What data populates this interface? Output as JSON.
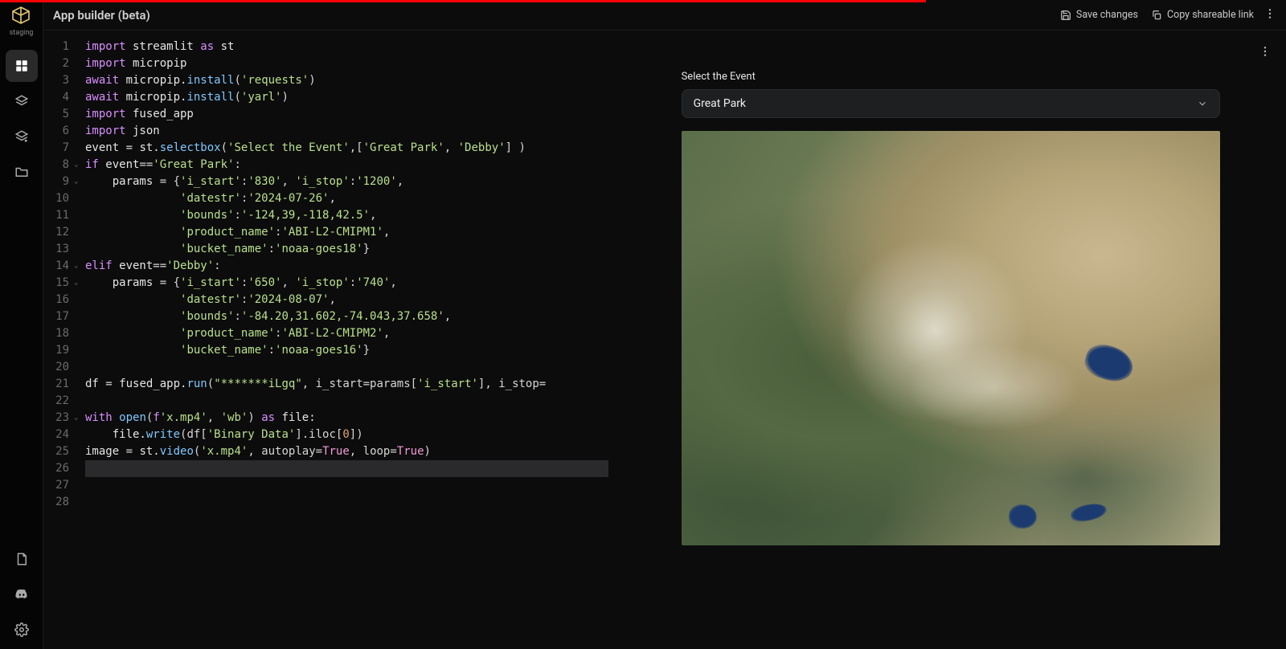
{
  "env_label": "staging",
  "header": {
    "title": "App builder (beta)",
    "save": "Save changes",
    "copy": "Copy shareable link"
  },
  "preview": {
    "label": "Select the Event",
    "selected": "Great Park"
  },
  "code": {
    "total_lines": 28,
    "fold_lines": [
      8,
      9,
      14,
      15,
      23
    ],
    "current_line": 26,
    "lines": [
      [
        [
          "kw",
          "import"
        ],
        [
          "ident",
          " streamlit "
        ],
        [
          "kw",
          "as"
        ],
        [
          "ident",
          " st"
        ]
      ],
      [
        [
          "kw",
          "import"
        ],
        [
          "ident",
          " micropip"
        ]
      ],
      [
        [
          "kw",
          "await"
        ],
        [
          "ident",
          " micropip."
        ],
        [
          "fn",
          "install"
        ],
        [
          "punc",
          "("
        ],
        [
          "str",
          "'requests'"
        ],
        [
          "punc",
          ")"
        ]
      ],
      [
        [
          "kw",
          "await"
        ],
        [
          "ident",
          " micropip."
        ],
        [
          "fn",
          "install"
        ],
        [
          "punc",
          "("
        ],
        [
          "str",
          "'yarl'"
        ],
        [
          "punc",
          ")"
        ]
      ],
      [
        [
          "kw",
          "import"
        ],
        [
          "ident",
          " fused_app"
        ]
      ],
      [
        [
          "kw",
          "import"
        ],
        [
          "ident",
          " json"
        ]
      ],
      [
        [
          "ident",
          "event "
        ],
        [
          "punc",
          "= "
        ],
        [
          "ident",
          "st."
        ],
        [
          "fn",
          "selectbox"
        ],
        [
          "punc",
          "("
        ],
        [
          "str",
          "'Select the Event'"
        ],
        [
          "punc",
          ",["
        ],
        [
          "str",
          "'Great Park'"
        ],
        [
          "punc",
          ", "
        ],
        [
          "str",
          "'Debby'"
        ],
        [
          "punc",
          "] )"
        ]
      ],
      [
        [
          "kw",
          "if"
        ],
        [
          "ident",
          " event"
        ],
        [
          "punc",
          "=="
        ],
        [
          "str",
          "'Great Park'"
        ],
        [
          "punc",
          ":"
        ]
      ],
      [
        [
          "ident",
          "    params "
        ],
        [
          "punc",
          "= {"
        ],
        [
          "str",
          "'i_start'"
        ],
        [
          "punc",
          ":"
        ],
        [
          "str",
          "'830'"
        ],
        [
          "punc",
          ", "
        ],
        [
          "str",
          "'i_stop'"
        ],
        [
          "punc",
          ":"
        ],
        [
          "str",
          "'1200'"
        ],
        [
          "punc",
          ","
        ]
      ],
      [
        [
          "ident",
          "              "
        ],
        [
          "str",
          "'datestr'"
        ],
        [
          "punc",
          ":"
        ],
        [
          "str",
          "'2024-07-26'"
        ],
        [
          "punc",
          ","
        ]
      ],
      [
        [
          "ident",
          "              "
        ],
        [
          "str",
          "'bounds'"
        ],
        [
          "punc",
          ":"
        ],
        [
          "str",
          "'-124,39,-118,42.5'"
        ],
        [
          "punc",
          ","
        ]
      ],
      [
        [
          "ident",
          "              "
        ],
        [
          "str",
          "'product_name'"
        ],
        [
          "punc",
          ":"
        ],
        [
          "str",
          "'ABI-L2-CMIPM1'"
        ],
        [
          "punc",
          ","
        ]
      ],
      [
        [
          "ident",
          "              "
        ],
        [
          "str",
          "'bucket_name'"
        ],
        [
          "punc",
          ":"
        ],
        [
          "str",
          "'noaa-goes18'"
        ],
        [
          "punc",
          "}"
        ]
      ],
      [
        [
          "kw",
          "elif"
        ],
        [
          "ident",
          " event"
        ],
        [
          "punc",
          "=="
        ],
        [
          "str",
          "'Debby'"
        ],
        [
          "punc",
          ":"
        ]
      ],
      [
        [
          "ident",
          "    params "
        ],
        [
          "punc",
          "= {"
        ],
        [
          "str",
          "'i_start'"
        ],
        [
          "punc",
          ":"
        ],
        [
          "str",
          "'650'"
        ],
        [
          "punc",
          ", "
        ],
        [
          "str",
          "'i_stop'"
        ],
        [
          "punc",
          ":"
        ],
        [
          "str",
          "'740'"
        ],
        [
          "punc",
          ","
        ]
      ],
      [
        [
          "ident",
          "              "
        ],
        [
          "str",
          "'datestr'"
        ],
        [
          "punc",
          ":"
        ],
        [
          "str",
          "'2024-08-07'"
        ],
        [
          "punc",
          ","
        ]
      ],
      [
        [
          "ident",
          "              "
        ],
        [
          "str",
          "'bounds'"
        ],
        [
          "punc",
          ":"
        ],
        [
          "str",
          "'-84.20,31.602,-74.043,37.658'"
        ],
        [
          "punc",
          ","
        ]
      ],
      [
        [
          "ident",
          "              "
        ],
        [
          "str",
          "'product_name'"
        ],
        [
          "punc",
          ":"
        ],
        [
          "str",
          "'ABI-L2-CMIPM2'"
        ],
        [
          "punc",
          ","
        ]
      ],
      [
        [
          "ident",
          "              "
        ],
        [
          "str",
          "'bucket_name'"
        ],
        [
          "punc",
          ":"
        ],
        [
          "str",
          "'noaa-goes16'"
        ],
        [
          "punc",
          "}"
        ]
      ],
      [],
      [
        [
          "ident",
          "df "
        ],
        [
          "punc",
          "= "
        ],
        [
          "ident",
          "fused_app."
        ],
        [
          "fn",
          "run"
        ],
        [
          "punc",
          "("
        ],
        [
          "str",
          "\"*******iLgq\""
        ],
        [
          "punc",
          ", i_start=params["
        ],
        [
          "str",
          "'i_start'"
        ],
        [
          "punc",
          "], i_stop="
        ]
      ],
      [],
      [
        [
          "kw",
          "with"
        ],
        [
          "ident",
          " "
        ],
        [
          "fn",
          "open"
        ],
        [
          "punc",
          "("
        ],
        [
          "kw",
          "f"
        ],
        [
          "str",
          "'x.mp4'"
        ],
        [
          "punc",
          ", "
        ],
        [
          "str",
          "'wb'"
        ],
        [
          "punc",
          ") "
        ],
        [
          "kw",
          "as"
        ],
        [
          "ident",
          " file:"
        ]
      ],
      [
        [
          "ident",
          "    file."
        ],
        [
          "fn",
          "write"
        ],
        [
          "punc",
          "(df["
        ],
        [
          "str",
          "'Binary Data'"
        ],
        [
          "punc",
          "].iloc["
        ],
        [
          "num-tok",
          "0"
        ],
        [
          "punc",
          "])"
        ]
      ],
      [
        [
          "ident",
          "image "
        ],
        [
          "punc",
          "= "
        ],
        [
          "ident",
          "st."
        ],
        [
          "fn",
          "video"
        ],
        [
          "punc",
          "("
        ],
        [
          "str",
          "'x.mp4'"
        ],
        [
          "punc",
          ", autoplay="
        ],
        [
          "bool",
          "True"
        ],
        [
          "punc",
          ", loop="
        ],
        [
          "bool",
          "True"
        ],
        [
          "punc",
          ")"
        ]
      ],
      [],
      [],
      []
    ]
  }
}
